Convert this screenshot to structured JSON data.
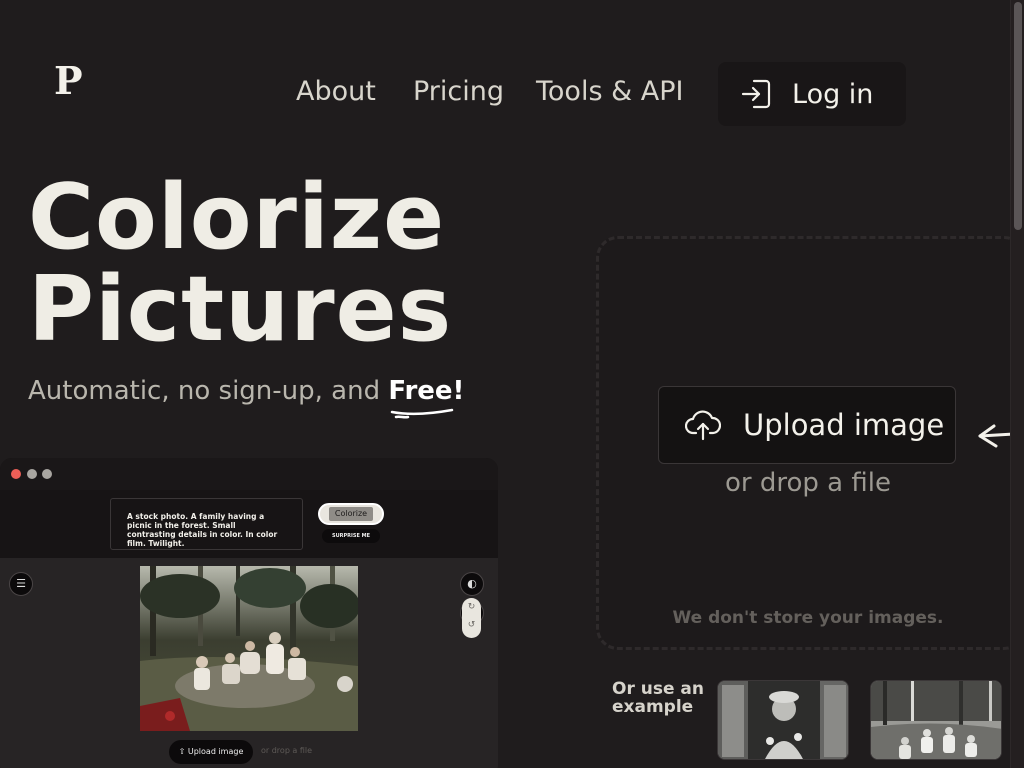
{
  "brand": {
    "logo_letter": "P"
  },
  "nav": {
    "about": "About",
    "pricing": "Pricing",
    "tools": "Tools & API",
    "login": "Log in"
  },
  "hero": {
    "title_line1": "Colorize",
    "title_line2": "Pictures",
    "subtitle_prefix": "Automatic, no sign-up, and ",
    "subtitle_highlight": "Free!"
  },
  "preview": {
    "prompt_text": "A stock photo. A family having a picnic in the forest. Small contrasting details in color. In color film. Twilight.",
    "colorize_label": "Colorize",
    "surprise_label": "SURPRISE ME",
    "upload_label": "Upload image",
    "drop_label": "or drop a file"
  },
  "uploader": {
    "upload_label": "Upload image",
    "drop_text": "or drop a file",
    "privacy_text": "We don't store your images."
  },
  "examples": {
    "label": "Or use an example"
  },
  "colors": {
    "background": "#1f1c1d",
    "text": "#ecebe4",
    "traffic_red": "#ec5f57",
    "traffic_gray": "#a9a6a1"
  }
}
